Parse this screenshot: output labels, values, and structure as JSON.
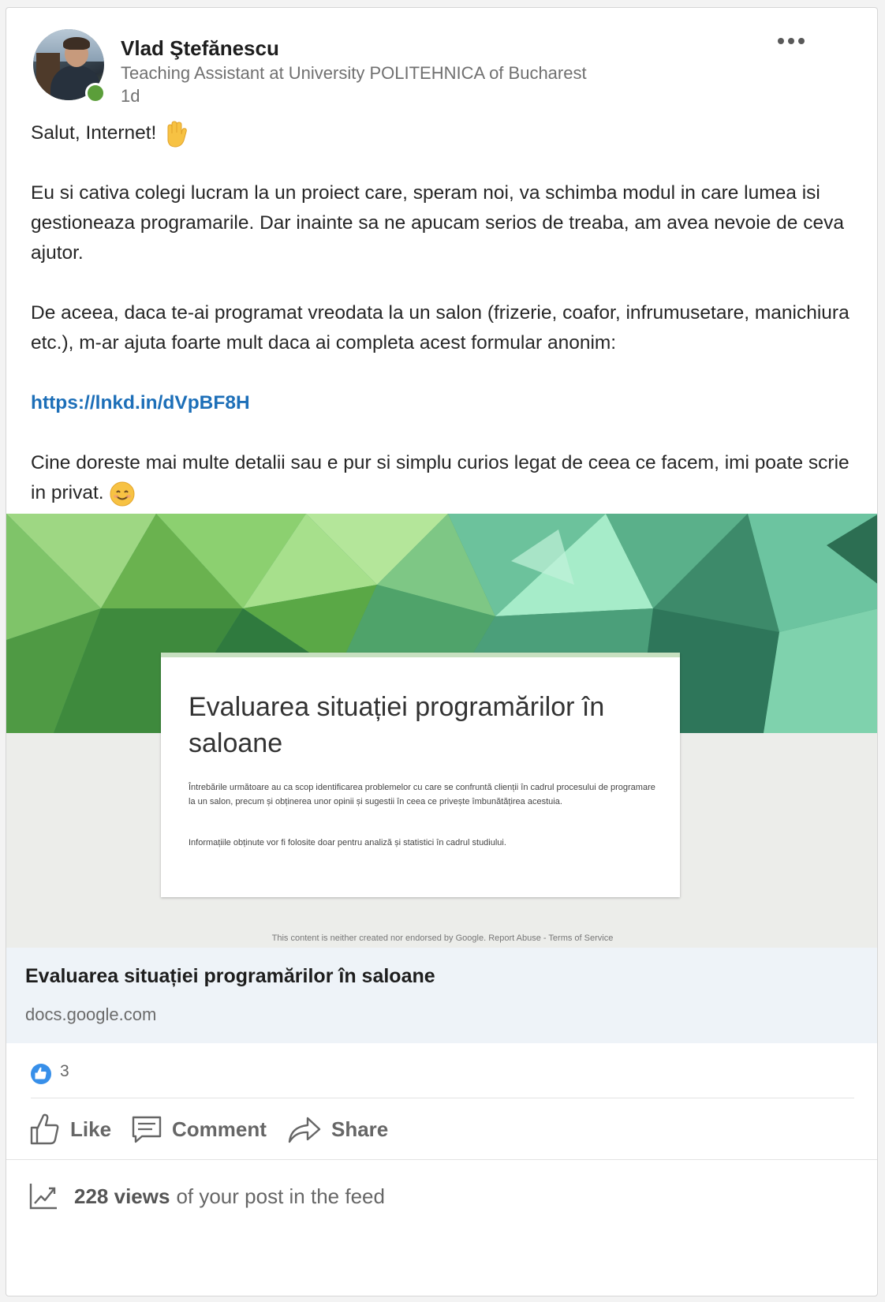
{
  "post": {
    "author_name": "Vlad Ştefănescu",
    "author_headline": "Teaching Assistant at University POLITEHNICA of Bucharest",
    "time_ago": "1d",
    "greeting": "Salut, Internet!",
    "paragraph1": "Eu si cativa colegi lucram la un proiect care, speram noi, va schimba modul in care lumea isi gestioneaza programarile. Dar inainte sa ne apucam serios de treaba, am avea nevoie de ceva ajutor.",
    "paragraph2": "De aceea, daca te-ai programat vreodata la un salon (frizerie, coafor, infrumusetare, manichiura etc.), m-ar ajuta foarte mult daca ai completa acest formular anonim:",
    "link": "https://lnkd.in/dVpBF8H",
    "paragraph3": "Cine doreste mai multe detalii sau e pur si simplu curios legat de ceea ce facem, imi poate scrie in privat."
  },
  "preview": {
    "form_title": "Evaluarea situației programărilor în saloane",
    "form_description": "Întrebările următoare au ca scop identificarea problemelor cu care se confruntă clienții în cadrul procesului de programare la un salon, precum și obținerea unor opinii și sugestii în ceea ce privește îmbunătățirea acestuia.",
    "form_info": "Informațiile obținute vor fi folosite doar pentru analiză și statistici în cadrul studiului.",
    "disclaimer": "This content is neither created nor endorsed by Google. Report Abuse - Terms of Service",
    "link_title": "Evaluarea situației programărilor în saloane",
    "link_domain": "docs.google.com"
  },
  "social": {
    "reaction_count": "3",
    "like_label": "Like",
    "comment_label": "Comment",
    "share_label": "Share",
    "views_number": "228 views",
    "views_rest": "of your post in the feed"
  },
  "colors": {
    "link": "#1d6fb8",
    "online": "#5b9e3a",
    "like_badge": "#378fe9",
    "banner_green": "#3d8f6a"
  },
  "icons": [
    "more-icon",
    "raised-hand-emoji",
    "smiling-face-emoji",
    "like-reaction-icon",
    "like-icon",
    "comment-icon",
    "share-icon",
    "analytics-icon"
  ]
}
